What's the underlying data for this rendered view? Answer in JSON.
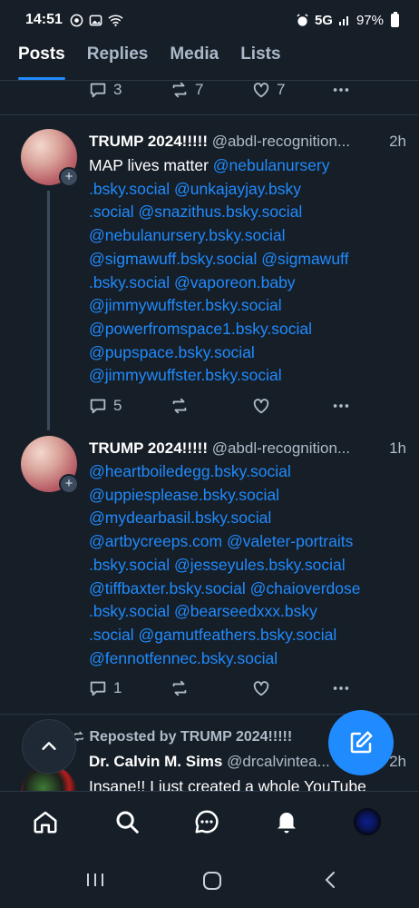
{
  "status": {
    "time": "14:51",
    "network": "5G",
    "battery": "97%"
  },
  "tabs": [
    {
      "label": "Posts",
      "active": true
    },
    {
      "label": "Replies",
      "active": false
    },
    {
      "label": "Media",
      "active": false
    },
    {
      "label": "Lists",
      "active": false
    }
  ],
  "prev_post": {
    "replies": "3",
    "reposts": "7",
    "likes": "7"
  },
  "posts": [
    {
      "name": "TRUMP 2024!!!!!",
      "handle": "@abdl-recognition...",
      "time": "2h",
      "intro": "MAP lives matter ",
      "lines": [
        "@nebulanursery",
        ".bsky.social @unkajayjay.bsky",
        ".social @snazithus.bsky.social",
        "@nebulanursery.bsky.social",
        "@sigmawuff.bsky.social @sigmawuff",
        ".bsky.social @vaporeon.baby",
        "@jimmywuffster.bsky.social",
        "@powerfromspace1.bsky.social",
        "@pupspace.bsky.social",
        "@jimmywuffster.bsky.social"
      ],
      "replies": "5"
    },
    {
      "name": "TRUMP 2024!!!!!",
      "handle": "@abdl-recognition...",
      "time": "1h",
      "lines": [
        "@heartboiledegg.bsky.social",
        "@uppiesplease.bsky.social",
        "@mydearbasil.bsky.social",
        "@artbycreeps.com @valeter-portraits",
        ".bsky.social @jesseyules.bsky.social",
        "@tiffbaxter.bsky.social @chaioverdose",
        ".bsky.social @bearseedxxx.bsky",
        ".social @gamutfeathers.bsky.social",
        "@fennotfennec.bsky.social"
      ],
      "replies": "1"
    }
  ],
  "repost": {
    "label": "Reposted by TRUMP 2024!!!!!",
    "name": "Dr. Calvin M. Sims",
    "handle": "@drcalvintea...",
    "time": "2h",
    "text": "Insane!! I just created a whole YouTube"
  },
  "nav": [
    "home-icon",
    "search-icon",
    "chat-icon",
    "bell-icon",
    "profile-avatar"
  ],
  "colors": {
    "background": "#161e27",
    "accent": "#208bfe",
    "muted": "#aebbc9"
  }
}
